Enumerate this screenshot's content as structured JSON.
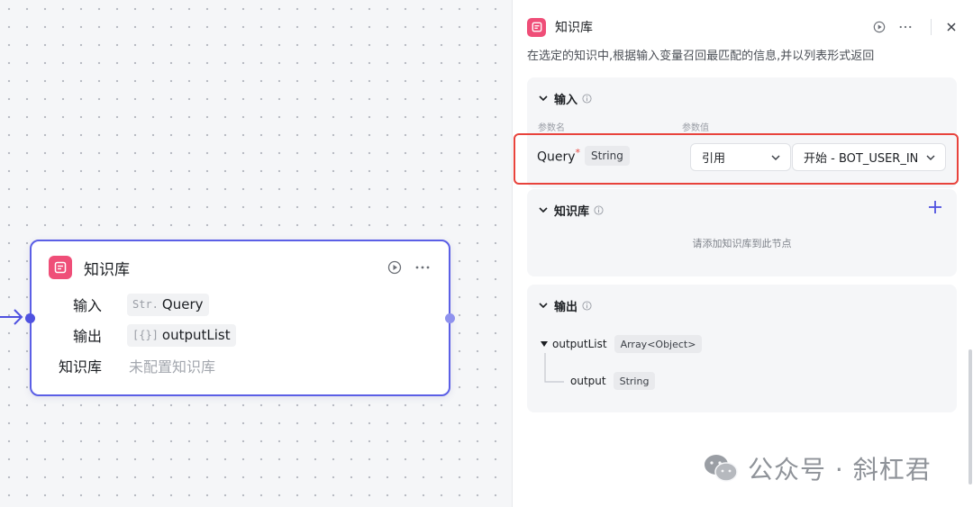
{
  "node": {
    "title": "知识库",
    "rows": [
      {
        "label": "输入",
        "type_tag": "Str.",
        "value": "Query"
      },
      {
        "label": "输出",
        "type_tag": "[{}]",
        "value": "outputList"
      },
      {
        "label": "知识库",
        "placeholder": "未配置知识库"
      }
    ]
  },
  "panel": {
    "title": "知识库",
    "description": "在选定的知识中,根据输入变量召回最匹配的信息,并以列表形式返回",
    "input_section": {
      "title": "输入",
      "col_name": "参数名",
      "col_value": "参数值",
      "param": {
        "name": "Query",
        "required_mark": "*",
        "type": "String",
        "mode": "引用",
        "reference": "开始 - BOT_USER_IN"
      }
    },
    "kb_section": {
      "title": "知识库",
      "empty_text": "请添加知识库到此节点"
    },
    "output_section": {
      "title": "输出",
      "items": [
        {
          "name": "outputList",
          "type": "Array<Object>"
        },
        {
          "name": "output",
          "type": "String"
        }
      ]
    }
  },
  "watermark": {
    "text": "公众号 · 斜杠君"
  },
  "colors": {
    "accent": "#5b5fe6",
    "kb_icon": "#ef4e78",
    "highlight": "#e8433c"
  },
  "icons": [
    "knowledge-base-icon",
    "play-icon",
    "more-icon",
    "close-icon",
    "chevron-down-icon",
    "info-icon",
    "plus-icon",
    "caret-down-icon",
    "wechat-icon"
  ]
}
